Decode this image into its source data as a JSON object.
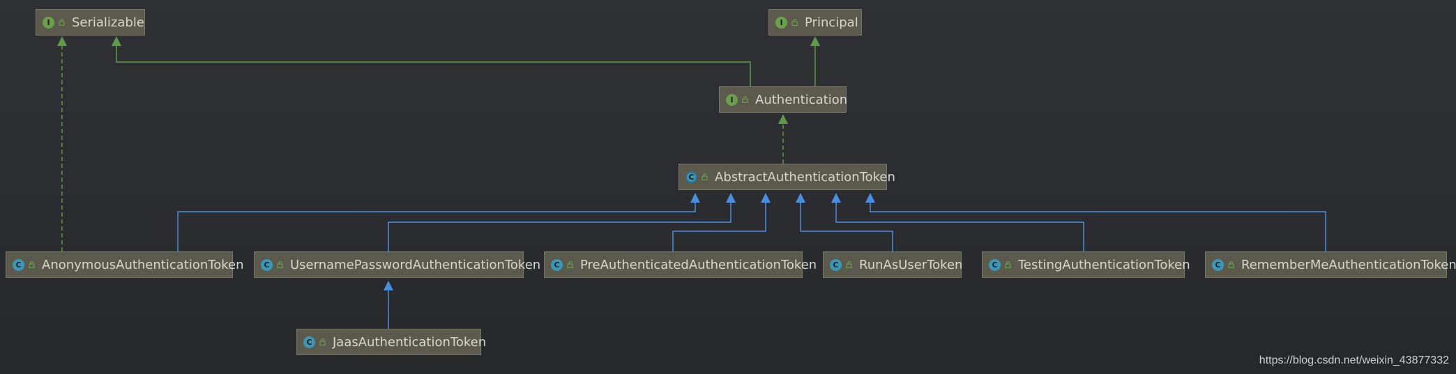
{
  "diagram": {
    "nodes": [
      {
        "id": "serializable",
        "label": "Serializable",
        "kind": "interface",
        "kind_letter": "I",
        "icon": "interface-icon"
      },
      {
        "id": "principal",
        "label": "Principal",
        "kind": "interface",
        "kind_letter": "I",
        "icon": "interface-icon"
      },
      {
        "id": "authentication",
        "label": "Authentication",
        "kind": "interface",
        "kind_letter": "I",
        "icon": "interface-icon"
      },
      {
        "id": "abstract_token",
        "label": "AbstractAuthenticationToken",
        "kind": "abstract",
        "kind_letter": "C",
        "icon": "abstract-class-icon"
      },
      {
        "id": "anonymous",
        "label": "AnonymousAuthenticationToken",
        "kind": "class",
        "kind_letter": "C",
        "icon": "class-icon"
      },
      {
        "id": "username_password",
        "label": "UsernamePasswordAuthenticationToken",
        "kind": "class",
        "kind_letter": "C",
        "icon": "class-icon"
      },
      {
        "id": "pre_authenticated",
        "label": "PreAuthenticatedAuthenticationToken",
        "kind": "class",
        "kind_letter": "C",
        "icon": "class-icon"
      },
      {
        "id": "run_as_user",
        "label": "RunAsUserToken",
        "kind": "class",
        "kind_letter": "C",
        "icon": "class-icon"
      },
      {
        "id": "testing",
        "label": "TestingAuthenticationToken",
        "kind": "class",
        "kind_letter": "C",
        "icon": "class-icon"
      },
      {
        "id": "remember_me",
        "label": "RememberMeAuthenticationToken",
        "kind": "class",
        "kind_letter": "C",
        "icon": "class-icon"
      },
      {
        "id": "jaas",
        "label": "JaasAuthenticationToken",
        "kind": "class",
        "kind_letter": "C",
        "icon": "class-icon"
      }
    ],
    "edges": [
      {
        "from": "authentication",
        "to": "serializable",
        "type": "extends"
      },
      {
        "from": "authentication",
        "to": "principal",
        "type": "extends"
      },
      {
        "from": "abstract_token",
        "to": "authentication",
        "type": "implements"
      },
      {
        "from": "anonymous",
        "to": "serializable",
        "type": "implements"
      },
      {
        "from": "anonymous",
        "to": "abstract_token",
        "type": "extends"
      },
      {
        "from": "username_password",
        "to": "abstract_token",
        "type": "extends"
      },
      {
        "from": "pre_authenticated",
        "to": "abstract_token",
        "type": "extends"
      },
      {
        "from": "run_as_user",
        "to": "abstract_token",
        "type": "extends"
      },
      {
        "from": "testing",
        "to": "abstract_token",
        "type": "extends"
      },
      {
        "from": "remember_me",
        "to": "abstract_token",
        "type": "extends"
      },
      {
        "from": "jaas",
        "to": "username_password",
        "type": "extends"
      }
    ],
    "colors": {
      "interface_edge": "#5f9a48",
      "class_edge": "#4a8fdf",
      "node_fill": "#5b5a4c",
      "node_border": "#78776a",
      "node_text": "#d6d6d0",
      "background": "#2b2d30"
    }
  },
  "watermark": "https://blog.csdn.net/weixin_43877332"
}
